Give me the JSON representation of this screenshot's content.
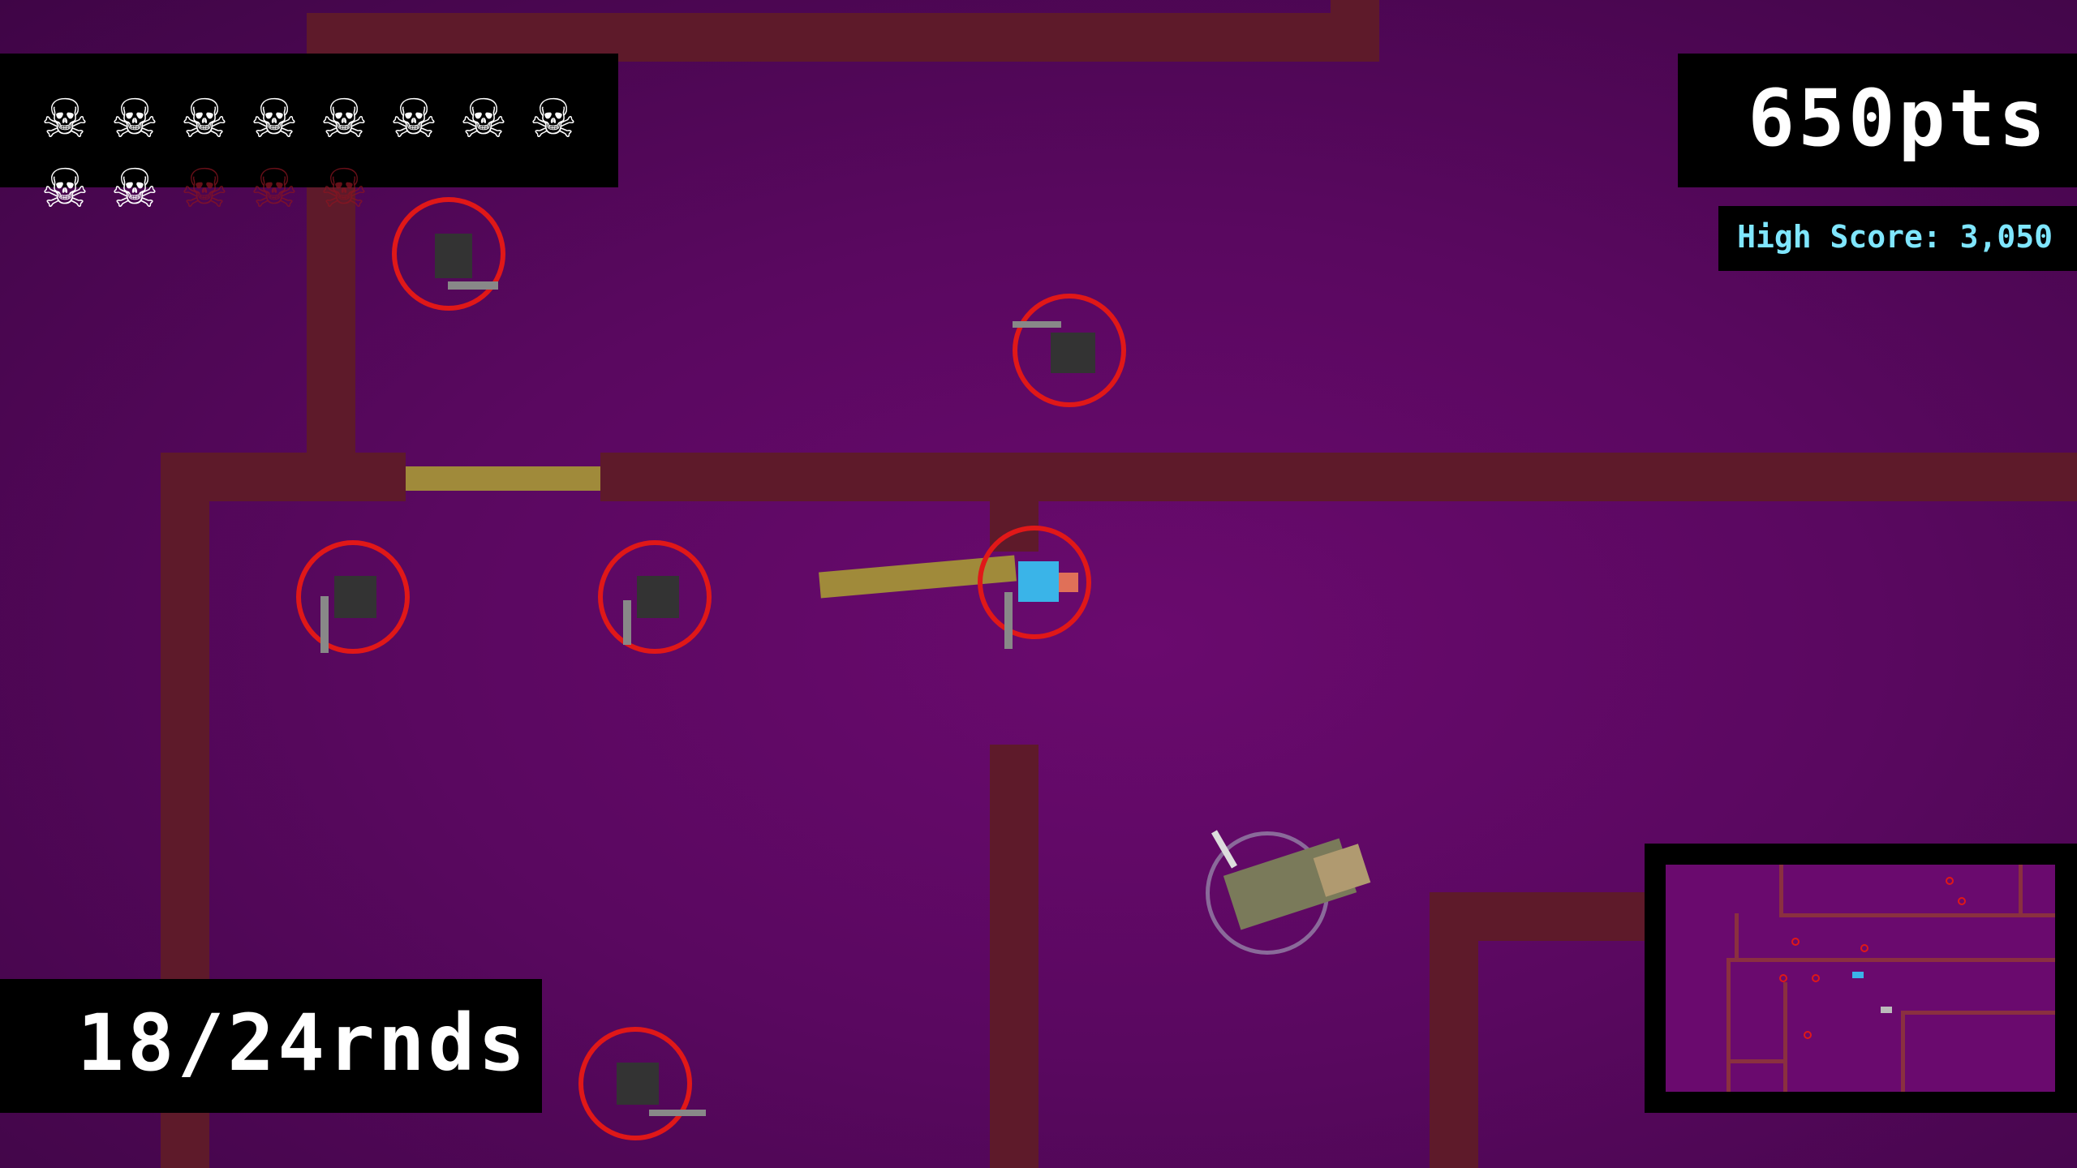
{
  "hud": {
    "kills_filled": 10,
    "kills_total": 13,
    "skull_glyph": "☠",
    "points": "650pts",
    "high_score": "High Score: 3,050",
    "ammo": "18/24rnds"
  },
  "colors": {
    "floor": "#6a0a6e",
    "wall": "#5e1a2a",
    "door": "#a08a3a",
    "enemy_ring": "#e01818",
    "player_ring": "#8a6a9a",
    "high_score_text": "#7fe6ff",
    "hud_text": "#ffffff"
  },
  "entities": {
    "enemies": 7,
    "player": 1
  }
}
